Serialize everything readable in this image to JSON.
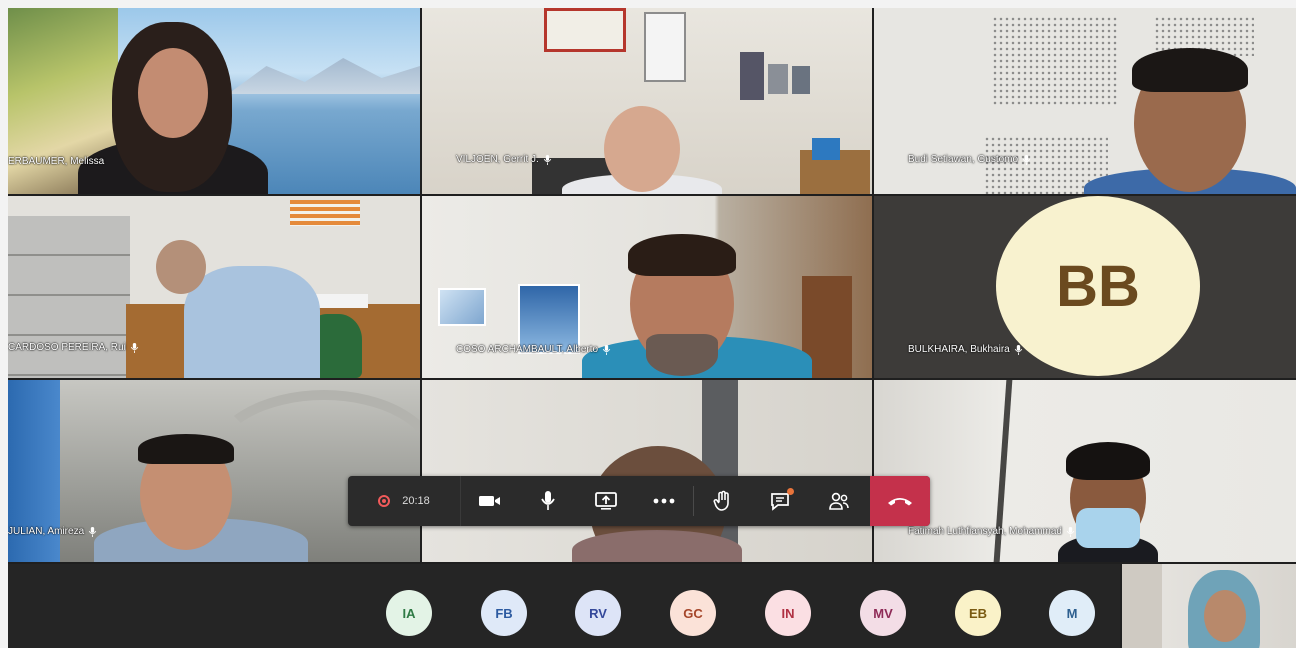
{
  "participants": [
    {
      "name": "ERBAUMER, Melissa"
    },
    {
      "name": "VILJOEN, Gerrit J."
    },
    {
      "name": "Budi Setiawan, Gustomo"
    },
    {
      "name": "CARDOSO PEREIRA, Rui"
    },
    {
      "name": "COSO ARCHAMBAULT, Alberto"
    },
    {
      "name": "BULKHAIRA, Bukhaira",
      "initials": "BB"
    },
    {
      "name": "JULIAN, Amireza"
    },
    {
      "name": ""
    },
    {
      "name": "Fatimah Luthfiansyah, Mohammad"
    }
  ],
  "toolbar": {
    "timer": "20:18",
    "icons": [
      "record-icon",
      "camera-icon",
      "microphone-icon",
      "share-screen-icon",
      "more-options-icon",
      "raise-hand-icon",
      "chat-icon",
      "people-icon",
      "hang-up-icon"
    ]
  },
  "avatars": [
    {
      "initials": "IA",
      "bg": "#e3f3e6",
      "fg": "#2f7a45"
    },
    {
      "initials": "FB",
      "bg": "#dfe9f8",
      "fg": "#2c5aa0"
    },
    {
      "initials": "RV",
      "bg": "#dde4f7",
      "fg": "#34489a"
    },
    {
      "initials": "GC",
      "bg": "#fbe2d8",
      "fg": "#a5462a"
    },
    {
      "initials": "IN",
      "bg": "#fbdfe3",
      "fg": "#b03042"
    },
    {
      "initials": "MV",
      "bg": "#f3dde6",
      "fg": "#8e2b57"
    },
    {
      "initials": "EB",
      "bg": "#faf2c8",
      "fg": "#7a5b12"
    },
    {
      "initials": "M",
      "bg": "#e0edf8",
      "fg": "#2d5f8f"
    }
  ],
  "colors": {
    "hangup": "#c4314b",
    "toolbar": "#2b2b2b",
    "stage": "#1f1f1f",
    "unread_dot": "#e8743b"
  }
}
